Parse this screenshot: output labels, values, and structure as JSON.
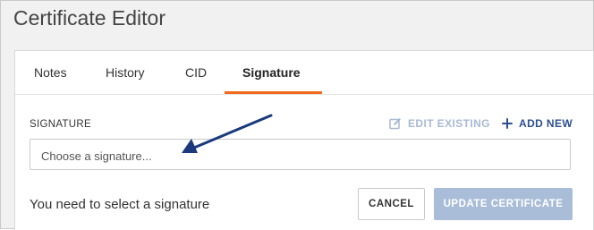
{
  "window": {
    "title": "Certificate Editor"
  },
  "tabs": [
    {
      "label": "Notes"
    },
    {
      "label": "History"
    },
    {
      "label": "CID"
    },
    {
      "label": "Signature"
    }
  ],
  "active_tab": "Signature",
  "signature": {
    "field_label": "SIGNATURE",
    "edit_existing_label": "EDIT EXISTING",
    "add_new_label": "ADD NEW",
    "select_placeholder": "Choose a signature..."
  },
  "footer": {
    "message": "You need to select a signature",
    "cancel_label": "CANCEL",
    "update_label": "UPDATE CERTIFICATE"
  },
  "colors": {
    "accent_tab": "#f26b1d",
    "link_primary": "#2c4f8f",
    "link_disabled": "#a8b9d3",
    "button_disabled": "#a9bdd8",
    "arrow": "#1a3a7c"
  },
  "icons": {
    "edit_existing": "pencil-square-icon",
    "add_new": "plus-icon",
    "annotation": "arrow-icon"
  }
}
